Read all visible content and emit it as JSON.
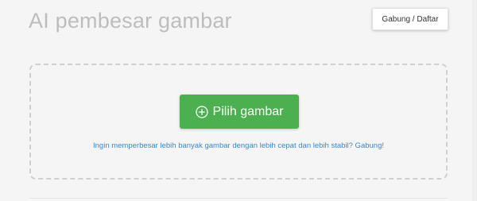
{
  "header": {
    "title": "AI pembesar gambar",
    "signup_label": "Gabung / Daftar"
  },
  "dropzone": {
    "pick_button_label": "Pilih gambar",
    "pick_button_icon": "plus-circle-icon",
    "promo_text": "Ingin memperbesar lebih banyak gambar dengan lebih cepat dan lebih stabil? Gabung!"
  },
  "colors": {
    "accent_green": "#4caf50",
    "link_blue": "#3a87d6",
    "title_gray": "#bdbdbd",
    "background": "#f5f5f5"
  }
}
